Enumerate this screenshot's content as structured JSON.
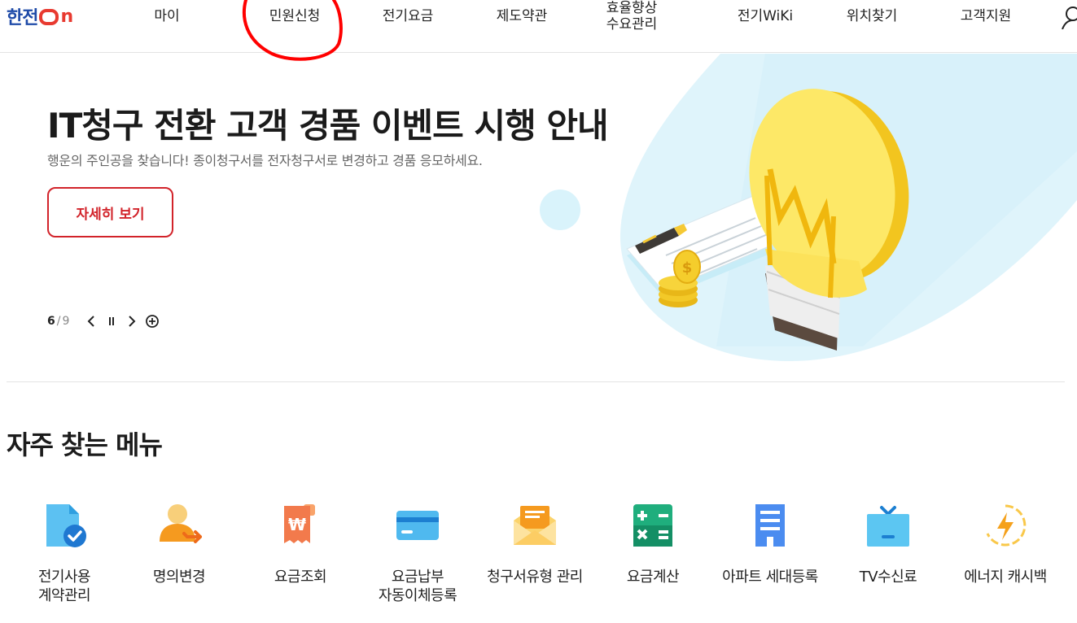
{
  "header": {
    "logo": {
      "text_kor": "한전",
      "text_on": "n"
    },
    "nav": [
      {
        "label": "마이"
      },
      {
        "label": "민원신청"
      },
      {
        "label": "전기요금"
      },
      {
        "label": "제도약관"
      },
      {
        "label_line1": "효율향상",
        "label_line2": "수요관리"
      },
      {
        "label": "전기WiKi"
      },
      {
        "label": "위치찾기"
      },
      {
        "label": "고객지원"
      }
    ]
  },
  "hero": {
    "title": "IT청구 전환 고객 경품 이벤트 시행 안내",
    "subtitle": "행운의 주인공을 찾습니다! 종이청구서를 전자청구서로 변경하고 경품 응모하세요.",
    "button_label": "자세히 보기",
    "slider": {
      "current": "6",
      "separator": "/",
      "total": "9"
    }
  },
  "frequent": {
    "title": "자주 찾는 메뉴",
    "items": [
      {
        "label": "전기사용\n계약관리",
        "icon": "contract-icon"
      },
      {
        "label": "명의변경",
        "icon": "name-change-icon"
      },
      {
        "label": "요금조회",
        "icon": "bill-icon"
      },
      {
        "label": "요금납부\n자동이체등록",
        "icon": "card-icon"
      },
      {
        "label": "청구서유형 관리",
        "icon": "envelope-icon"
      },
      {
        "label": "요금계산",
        "icon": "calculator-icon"
      },
      {
        "label": "아파트 세대등록",
        "icon": "apartment-icon"
      },
      {
        "label": "TV수신료",
        "icon": "tv-icon"
      },
      {
        "label": "에너지 캐시백",
        "icon": "energy-cashback-icon"
      }
    ]
  },
  "colors": {
    "brand_blue": "#1e4aa8",
    "brand_red": "#e83a30",
    "accent_red": "#d2232a",
    "annotation_red": "#ff0000"
  }
}
